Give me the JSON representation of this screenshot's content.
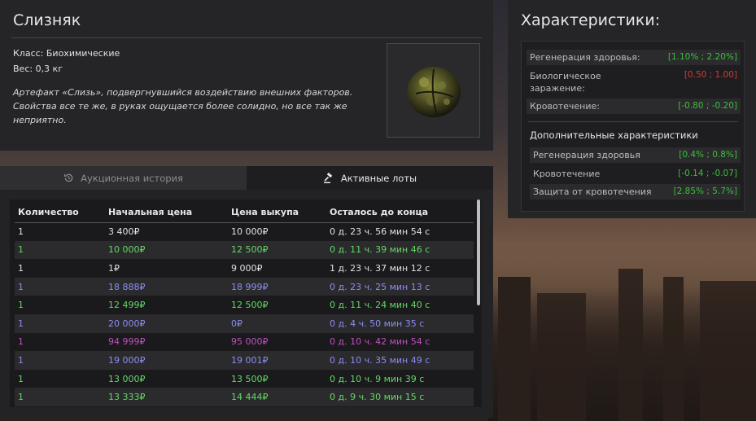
{
  "item": {
    "title": "Слизняк",
    "class_label": "Класс: Биохимические",
    "weight_label": "Вес: 0,3 кг",
    "description": "Артефакт «Слизь», подвергнувшийся воздействию внешних факторов. Свойства все те же, в руках ощущается более солидно, но все так же неприятно."
  },
  "stats": {
    "title": "Характеристики:",
    "main": [
      {
        "name": "Регенерация здоровья:",
        "value": "[1.10% ; 2.20%]",
        "color": "green"
      },
      {
        "name": "Биологическое заражение:",
        "value": "[0.50 ; 1.00]",
        "color": "red"
      },
      {
        "name": "Кровотечение:",
        "value": "[-0.80 ; -0.20]",
        "color": "green"
      }
    ],
    "additional_title": "Дополнительные характеристики",
    "additional": [
      {
        "name": "Регенерация здоровья",
        "value": "[0.4% ; 0.8%]",
        "color": "green"
      },
      {
        "name": "Кровотечение",
        "value": "[-0.14 ; -0.07]",
        "color": "green"
      },
      {
        "name": "Защита от кровотечения",
        "value": "[2.85% ; 5.7%]",
        "color": "green"
      }
    ]
  },
  "tabs": {
    "history": "Аукционная история",
    "active": "Активные лоты"
  },
  "lots": {
    "headers": [
      "Количество",
      "Начальная цена",
      "Цена выкупа",
      "Осталось до конца"
    ],
    "rows": [
      {
        "qty": "1",
        "start": "3 400₽",
        "buyout": "10 000₽",
        "left": "0 д. 23 ч. 56 мин 54 с",
        "color": "white"
      },
      {
        "qty": "1",
        "start": "10 000₽",
        "buyout": "12 500₽",
        "left": "0 д. 11 ч. 39 мин 46 с",
        "color": "green"
      },
      {
        "qty": "1",
        "start": "1₽",
        "buyout": "9 000₽",
        "left": "1 д. 23 ч. 37 мин 12 с",
        "color": "white"
      },
      {
        "qty": "1",
        "start": "18 888₽",
        "buyout": "18 999₽",
        "left": "0 д. 23 ч. 25 мин 13 с",
        "color": "blue"
      },
      {
        "qty": "1",
        "start": "12 499₽",
        "buyout": "12 500₽",
        "left": "0 д. 11 ч. 24 мин 40 с",
        "color": "green"
      },
      {
        "qty": "1",
        "start": "20 000₽",
        "buyout": "0₽",
        "left": "0 д. 4 ч. 50 мин 35 с",
        "color": "blue"
      },
      {
        "qty": "1",
        "start": "94 999₽",
        "buyout": "95 000₽",
        "left": "0 д. 10 ч. 42 мин 54 с",
        "color": "purple"
      },
      {
        "qty": "1",
        "start": "19 000₽",
        "buyout": "19 001₽",
        "left": "0 д. 10 ч. 35 мин 49 с",
        "color": "blue"
      },
      {
        "qty": "1",
        "start": "13 000₽",
        "buyout": "13 500₽",
        "left": "0 д. 10 ч. 9 мин 39 с",
        "color": "green"
      },
      {
        "qty": "1",
        "start": "13 333₽",
        "buyout": "14 444₽",
        "left": "0 д. 9 ч. 30 мин 15 с",
        "color": "green"
      }
    ]
  },
  "colors": {
    "green": "#3cbf3c",
    "red": "#d23a3a",
    "row_green": "#62d862",
    "row_blue": "#8c8cf0",
    "row_purple": "#c050c0"
  }
}
